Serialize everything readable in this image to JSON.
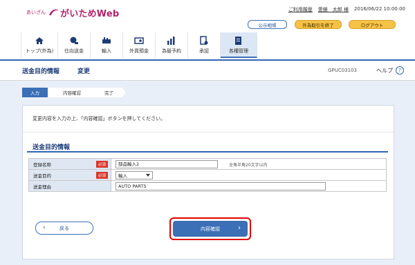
{
  "brand": {
    "small": "あいざん",
    "name": "がいためWeb"
  },
  "user": {
    "history_link": "ご利用履歴",
    "name": "愛銀　太郎 様",
    "datetime": "2016/06/22 10:00:00"
  },
  "top_buttons": {
    "rate": "公示相場",
    "end": "外為取引を終了",
    "logout": "ログアウト"
  },
  "nav": [
    {
      "label": "トップ(外為)",
      "icon": "home-icon"
    },
    {
      "label": "仕向送金",
      "icon": "remittance-icon"
    },
    {
      "label": "輸入",
      "icon": "import-icon"
    },
    {
      "label": "外貨預金",
      "icon": "deposit-icon"
    },
    {
      "label": "為替予約",
      "icon": "exchange-icon"
    },
    {
      "label": "承認",
      "icon": "approval-icon"
    },
    {
      "label": "各種管理",
      "icon": "management-icon"
    }
  ],
  "page": {
    "title": "送金目的情報",
    "subtitle": "変更",
    "screen_id": "GPUC03103",
    "help": "ヘルプ"
  },
  "steps": [
    "入力",
    "内容確認",
    "完了"
  ],
  "instruction": "変更内容を入力の上、「内容確認」ボタンを押してください。",
  "section": {
    "title": "送金目的情報"
  },
  "form": {
    "required": "必須",
    "rows": [
      {
        "label": "登録名称",
        "value": "部品輸入2",
        "hint": "全角半角20文字以内"
      },
      {
        "label": "送金目的",
        "value": "輸入"
      },
      {
        "label": "送金理由",
        "value": "AUTO PARTS"
      }
    ]
  },
  "buttons": {
    "back": "戻る",
    "confirm": "内容確認"
  },
  "colors": {
    "accent": "#3b6fb6",
    "brand": "#b3226a",
    "required": "#d9362b",
    "highlight": "#e00000"
  }
}
